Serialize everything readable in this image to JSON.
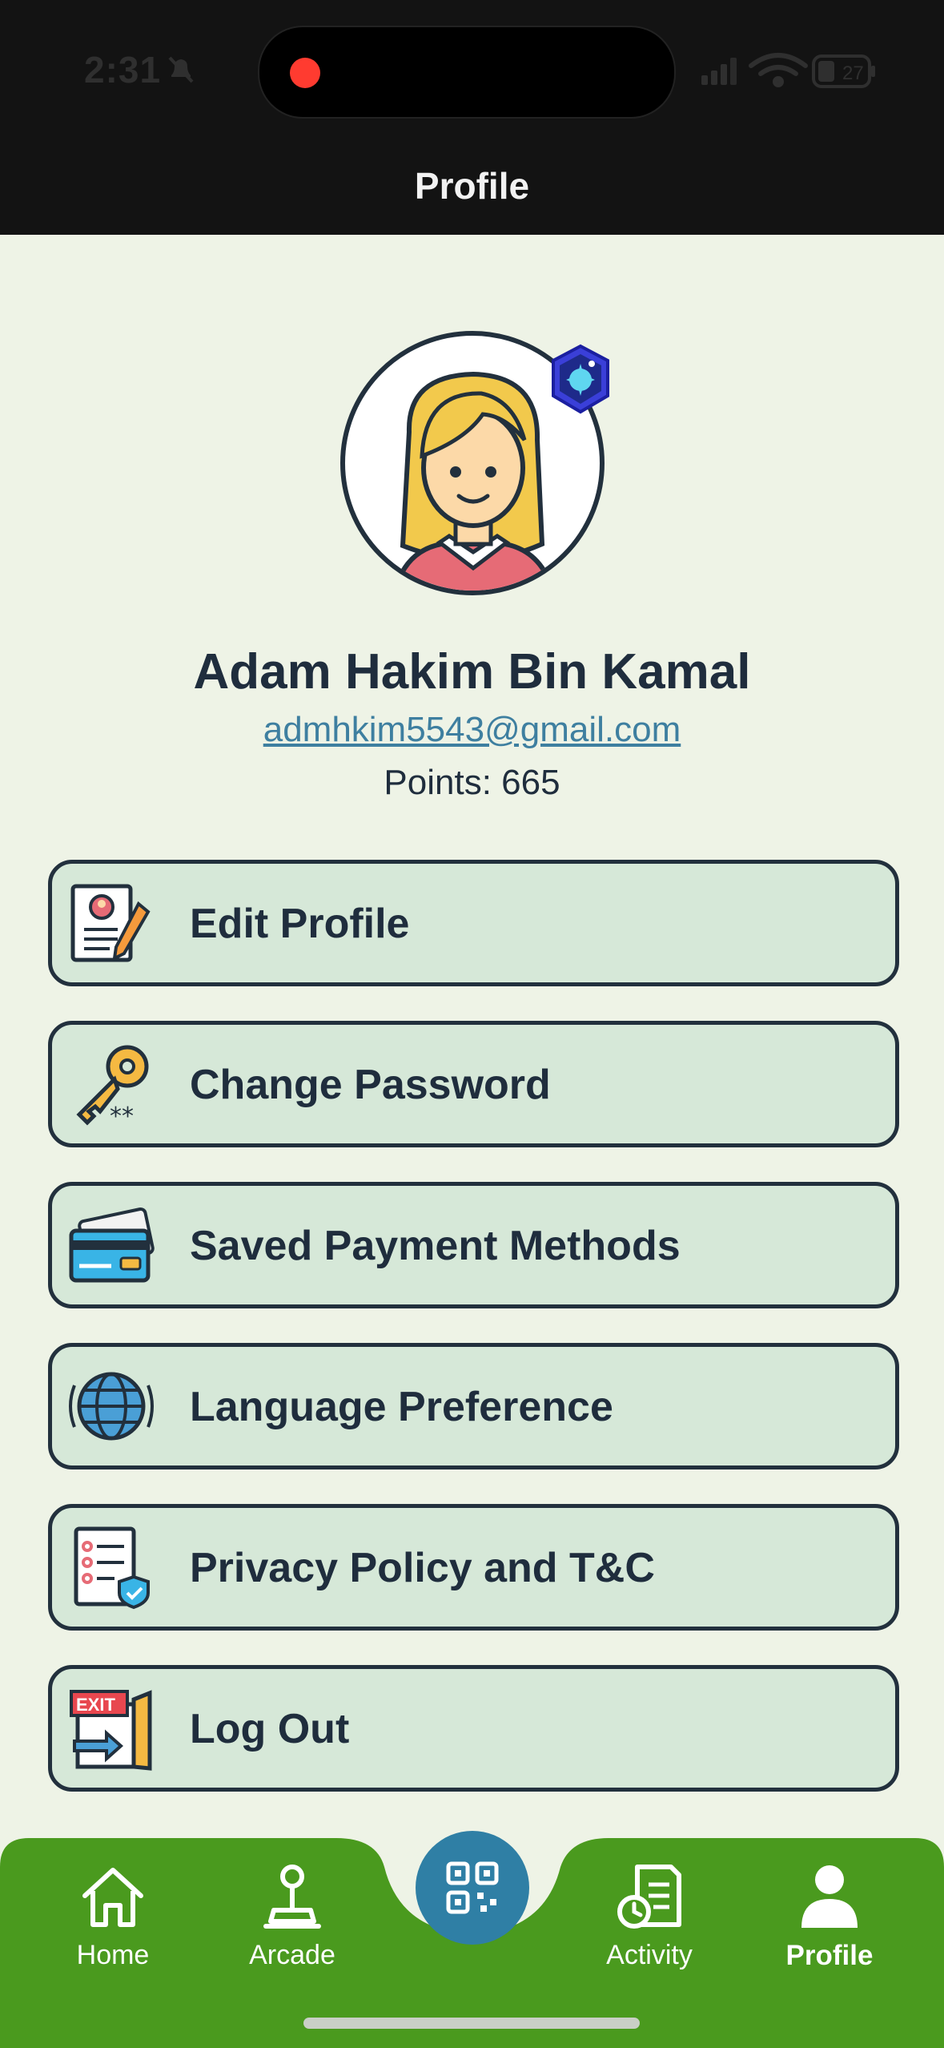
{
  "status_bar": {
    "time": "2:31",
    "battery": "27"
  },
  "header": {
    "title": "Profile"
  },
  "profile": {
    "name": "Adam Hakim Bin Kamal",
    "email": "admhkim5543@gmail.com",
    "points": "Points: 665"
  },
  "menu": [
    {
      "label": "Edit Profile",
      "icon": "edit-profile-icon"
    },
    {
      "label": "Change Password",
      "icon": "key-icon"
    },
    {
      "label": "Saved Payment Methods",
      "icon": "credit-card-icon"
    },
    {
      "label": "Language Preference",
      "icon": "globe-icon"
    },
    {
      "label": "Privacy Policy and T&C",
      "icon": "privacy-document-icon"
    },
    {
      "label": "Log Out",
      "icon": "exit-door-icon"
    }
  ],
  "bottom_nav": {
    "items": [
      {
        "label": "Home",
        "icon": "home-icon"
      },
      {
        "label": "Arcade",
        "icon": "joystick-icon"
      },
      {
        "label": "Activity",
        "icon": "activity-receipt-icon"
      },
      {
        "label": "Profile",
        "icon": "person-icon"
      }
    ],
    "center_icon": "qr-code-icon",
    "active": "Profile"
  },
  "colors": {
    "nav_green": "#4a9a1e",
    "page_bg": "#eef3e6",
    "menu_bg": "#d6e8d8",
    "scan_blue": "#2f7fa5",
    "email_link": "#3e7fa0"
  }
}
